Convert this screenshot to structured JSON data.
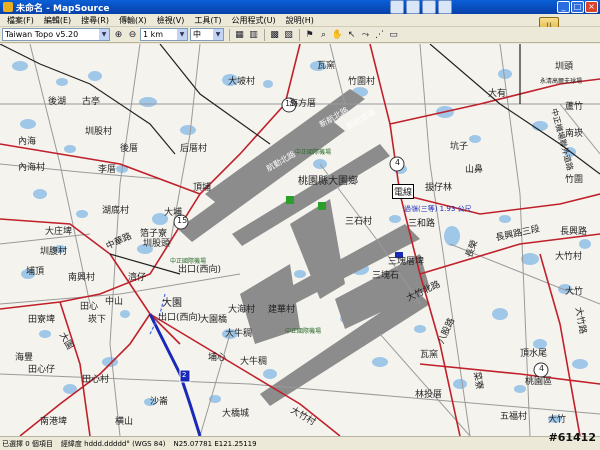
{
  "window": {
    "title": "未命名 - MapSource"
  },
  "menu": [
    "檔案(F)",
    "編輯(E)",
    "搜尋(R)",
    "傳輸(X)",
    "檢視(V)",
    "工具(T)",
    "公用程式(U)",
    "說明(H)"
  ],
  "toolbar": {
    "map_product": "Taiwan Topo v5.20",
    "zoom_scale": "1 km",
    "detail_level": "中"
  },
  "map": {
    "roads": {
      "r15": "15",
      "r4": "4",
      "r2": "2"
    },
    "labels": [
      "瓦窯",
      "竹圍村",
      "大坡村",
      "圳頭",
      "永清高爾夫球場",
      "後湖",
      "古亭",
      "海方厝",
      "大有",
      "蘆竹",
      "圳股村",
      "新航南路",
      "新航北路",
      "南崁",
      "內海",
      "後厝",
      "后厝村",
      "中正機場聯外道路",
      "坑子",
      "內海村",
      "李厝",
      "航勤北路",
      "中正國際機場",
      "山鼻",
      "頂埔",
      "桃園縣大園鄉",
      "電線",
      "拔仔林",
      "竹圍",
      "湖底村",
      "大埔",
      "箔子寮",
      "三石村",
      "長興路三段",
      "大庄埤",
      "中華路",
      "圳股頭",
      "三和路",
      "長興路",
      "圳腹村",
      "中正國際機場",
      "三塊厝埤",
      "長榮",
      "大竹村",
      "埔頂",
      "南興村",
      "濟仔",
      "出口(西向)",
      "三塊石",
      "大竹",
      "田心",
      "中山",
      "大園",
      "出口(西向)",
      "大園橋",
      "大竹北路",
      "田寮埤",
      "崁下",
      "大海村",
      "建華村",
      "中正國際機場",
      "田心仔",
      "大牛稠",
      "八股路",
      "大竹路",
      "大園",
      "埔心",
      "大牛稠",
      "海豐",
      "瓦窯",
      "頂水尾",
      "田心村",
      "沙崙",
      "林投厝",
      "菜寮",
      "桃園區",
      "南港埤",
      "横山",
      "大橋城",
      "大竹村",
      "五福村",
      "大竹"
    ],
    "poi": "過嶺(三等) 1.93 公尺"
  },
  "status": {
    "selected": "已選擇 0 個項目",
    "coord_format": "經緯度 hddd.ddddd° (WGS 84)",
    "coords": "N25.07781 E121.25119"
  },
  "watermark": "#61412"
}
